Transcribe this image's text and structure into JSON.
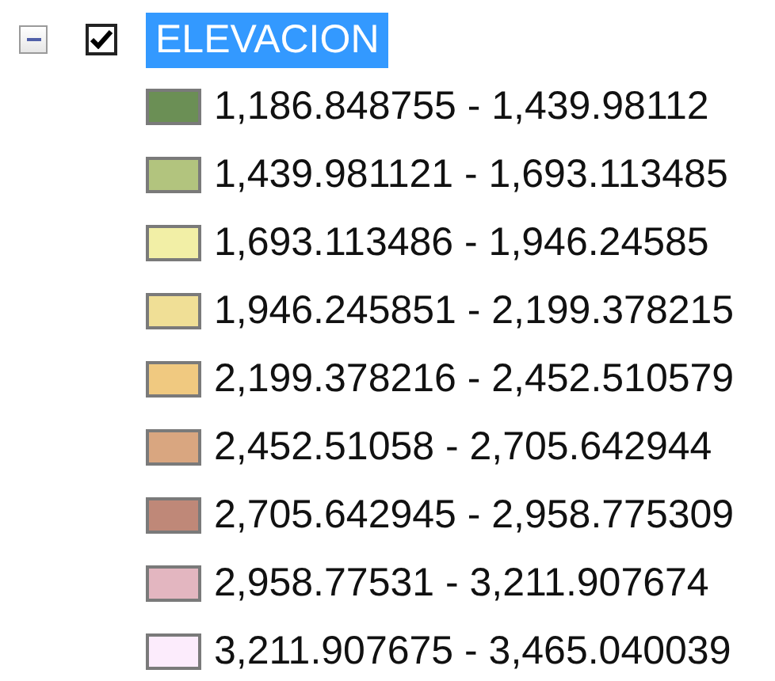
{
  "layer": {
    "name": "ELEVACION",
    "expanded": true,
    "checked": true,
    "selected": true
  },
  "classes": [
    {
      "label": "1,186.848755 - 1,439.98112",
      "color": "#6b8f55"
    },
    {
      "label": "1,439.981121 - 1,693.113485",
      "color": "#b2c47e"
    },
    {
      "label": "1,693.113486 - 1,946.24585",
      "color": "#f2efa6"
    },
    {
      "label": "1,946.245851 - 2,199.378215",
      "color": "#f0df96"
    },
    {
      "label": "2,199.378216 - 2,452.510579",
      "color": "#f0c980"
    },
    {
      "label": "2,452.51058 - 2,705.642944",
      "color": "#d9a680"
    },
    {
      "label": "2,705.642945 - 2,958.775309",
      "color": "#bf8878"
    },
    {
      "label": "2,958.77531 - 3,211.907674",
      "color": "#e3b6c0"
    },
    {
      "label": "3,211.907675 - 3,465.040039",
      "color": "#fcecfc"
    }
  ]
}
